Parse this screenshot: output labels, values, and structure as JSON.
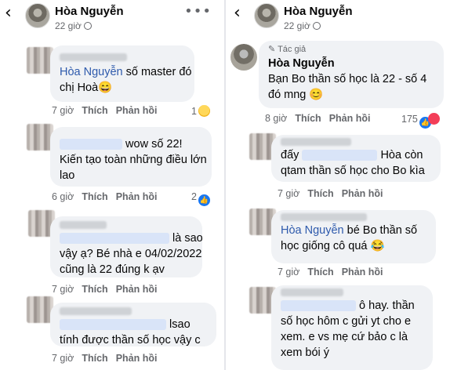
{
  "left": {
    "back_icon": "chevron-left-icon",
    "header": {
      "name": "Hòa Nguyễn",
      "time": "22 giờ"
    },
    "comments": [
      {
        "mention": "Hòa Nguyễn",
        "line1_rest": " số master đó",
        "line2": "chị Hoà😄",
        "time": "7 giờ",
        "like": "Thích",
        "reply": "Phản hồi",
        "count": "1"
      },
      {
        "line1_tail": "wow số 22!",
        "line2": "Kiến tạo toàn những điều lớn",
        "line3": "lao",
        "time": "6 giờ",
        "like": "Thích",
        "reply": "Phản hồi",
        "count": "2"
      },
      {
        "line1_tail": "là sao",
        "line2": "vậy ạ? Bé nhà e 04/02/2022",
        "line3": "cũng là 22 đúng k ạv",
        "time": "7 giờ",
        "like": "Thích",
        "reply": "Phản hồi"
      },
      {
        "line1_tail": "lsao",
        "line2": "tính được thần số học vậy c",
        "time": "7 giờ",
        "like": "Thích",
        "reply": "Phản hồi"
      }
    ]
  },
  "right": {
    "back_icon": "chevron-left-icon",
    "header": {
      "name": "Hòa Nguyễn",
      "time": "22 giờ"
    },
    "comments": [
      {
        "badge": "Tác giả",
        "name": "Hòa Nguyễn",
        "line1": "Bạn Bo thần số học là 22 - số 4",
        "line2": "đó mng 😊",
        "time": "8 giờ",
        "like": "Thích",
        "reply": "Phản hồi",
        "count": "175"
      },
      {
        "line1_head": "đấy",
        "line1_tail": "Hòa còn",
        "line2": "qtam thần số học cho Bo kìa",
        "time": "7 giờ",
        "like": "Thích",
        "reply": "Phản hồi"
      },
      {
        "mention": "Hòa Nguyễn",
        "line1_rest": " bé Bo thần số",
        "line2": "học giống cô quá 😂",
        "time": "7 giờ",
        "like": "Thích",
        "reply": "Phản hồi"
      },
      {
        "line1_tail": "ô hay. thần",
        "line2": "số học hôm c gửi yt cho e",
        "line3": "xem. e vs mẹ cứ bảo c là",
        "line4": "xem bói ý"
      }
    ]
  }
}
